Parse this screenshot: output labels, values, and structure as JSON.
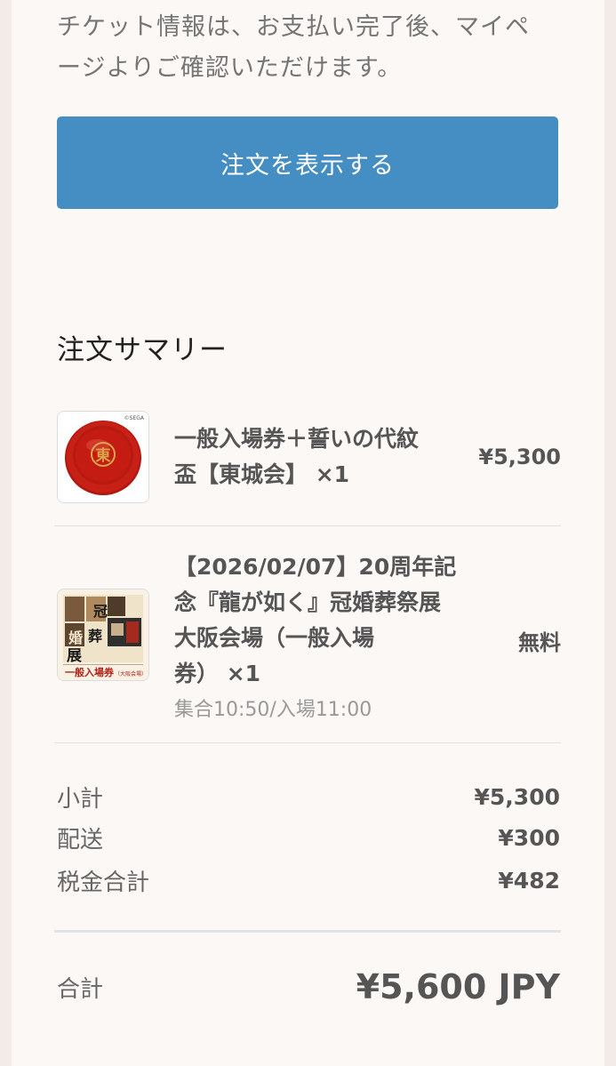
{
  "notice": {
    "line1": "チケット情報は、お支払い完了後、マイペ",
    "line2": "ージよりご確認いただけます。"
  },
  "view_order_button": "注文を表示する",
  "summary": {
    "title": "注文サマリー",
    "items": [
      {
        "name_line1": "一般入場券＋誓いの代紋",
        "name_line2": "盃【東城会】 ×1",
        "price": "¥5,300",
        "image_icon": "red-sake-cup-image",
        "image_mark": "東",
        "image_brand": "©SEGA"
      },
      {
        "name_line1": "【2026/02/07】20周年記",
        "name_line2": "念『龍が如く』冠婚葬祭展",
        "name_line3": "大阪会場（一般入場",
        "name_line4": "券） ×1",
        "subtext": "集合10:50/入場11:00",
        "price": "無料",
        "image_icon": "exhibition-poster-image",
        "image_caption": "一般入場券",
        "image_caption_sub": "（大阪会場）",
        "image_chars": [
          "冠",
          "婚",
          "葬",
          "展"
        ]
      }
    ]
  },
  "costs": {
    "subtotal_label": "小計",
    "subtotal_value": "¥5,300",
    "shipping_label": "配送",
    "shipping_value": "¥300",
    "tax_label": "税金合計",
    "tax_value": "¥482"
  },
  "total": {
    "label": "合計",
    "value": "¥5,600 JPY"
  },
  "colors": {
    "button": "#458ec3",
    "cup_red": "#c41c12",
    "cup_gold": "#d9a64a"
  }
}
